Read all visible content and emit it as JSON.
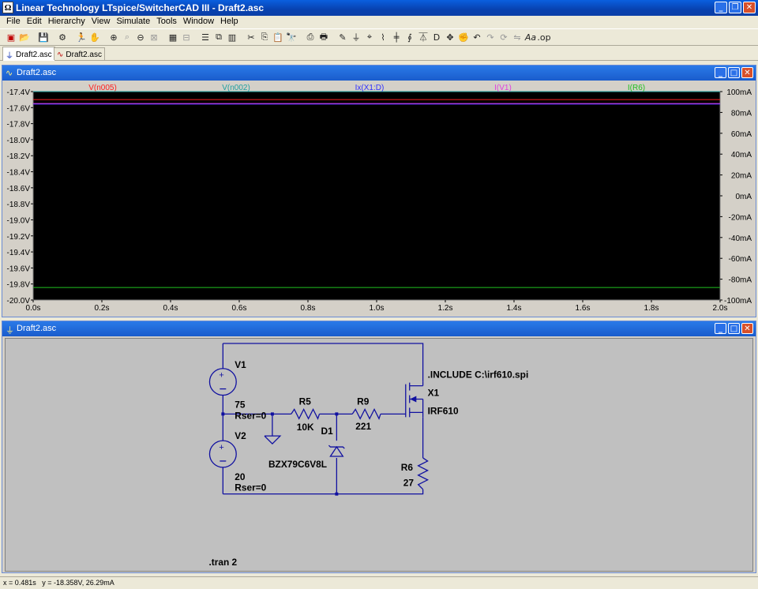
{
  "window": {
    "title": "Linear Technology LTspice/SwitcherCAD III - Draft2.asc"
  },
  "menu": [
    "File",
    "Edit",
    "Hierarchy",
    "View",
    "Simulate",
    "Tools",
    "Window",
    "Help"
  ],
  "tabs": [
    {
      "label": "Draft2.asc",
      "active": true
    },
    {
      "label": "Draft2.asc",
      "active": false
    }
  ],
  "wave_window": {
    "title": "Draft2.asc"
  },
  "schematic_window": {
    "title": "Draft2.asc"
  },
  "chart_data": {
    "type": "line",
    "xlabel": "",
    "ylabel": "",
    "x_ticks": [
      "0.0s",
      "0.2s",
      "0.4s",
      "0.6s",
      "0.8s",
      "1.0s",
      "1.2s",
      "1.4s",
      "1.6s",
      "1.8s",
      "2.0s"
    ],
    "xlim": [
      0,
      2.0
    ],
    "y_left_ticks": [
      "-17.4V",
      "-17.6V",
      "-17.8V",
      "-18.0V",
      "-18.2V",
      "-18.4V",
      "-18.6V",
      "-18.8V",
      "-19.0V",
      "-19.2V",
      "-19.4V",
      "-19.6V",
      "-19.8V",
      "-20.0V"
    ],
    "ylim_left": [
      -20.0,
      -17.4
    ],
    "y_right_ticks": [
      "100mA",
      "80mA",
      "60mA",
      "40mA",
      "20mA",
      "0mA",
      "-20mA",
      "-40mA",
      "-60mA",
      "-80mA",
      "-100mA"
    ],
    "ylim_right": [
      -100,
      100
    ],
    "series": [
      {
        "name": "V(n005)",
        "color": "#ff2020",
        "axis": "left",
        "x": [
          0,
          2.0
        ],
        "y": [
          -17.5,
          -17.5
        ]
      },
      {
        "name": "V(n002)",
        "color": "#20a0a0",
        "axis": "left",
        "x": [
          0,
          2.0
        ],
        "y": [
          -17.4,
          -17.4
        ]
      },
      {
        "name": "Ix(X1:D)",
        "color": "#3030ff",
        "axis": "right",
        "x": [
          0,
          2.0
        ],
        "y": [
          88,
          88
        ]
      },
      {
        "name": "I(V1)",
        "color": "#e040e0",
        "axis": "right",
        "x": [
          0,
          2.0
        ],
        "y": [
          88.5,
          88.5
        ]
      },
      {
        "name": "I(R6)",
        "color": "#20c020",
        "axis": "right",
        "x": [
          0,
          2.0
        ],
        "y": [
          -88,
          -88
        ]
      }
    ],
    "background": "#000000",
    "grid": false
  },
  "schematic": {
    "V1": {
      "name": "V1",
      "value": "75",
      "rser": "Rser=0"
    },
    "V2": {
      "name": "V2",
      "value": "20",
      "rser": "Rser=0"
    },
    "R5": {
      "name": "R5",
      "value": "10K"
    },
    "R9": {
      "name": "R9",
      "value": "221"
    },
    "R6": {
      "name": "R6",
      "value": "27"
    },
    "D1": {
      "name": "D1",
      "value": "BZX79C6V8L"
    },
    "X1": {
      "name": "X1",
      "value": "IRF610"
    },
    "include": ".INCLUDE C:\\irf610.spi",
    "tran": ".tran 2",
    "wire_color": "#1010a0"
  },
  "status": {
    "text": "x = 0.481s   y = -18.358V, 26.29mA"
  }
}
